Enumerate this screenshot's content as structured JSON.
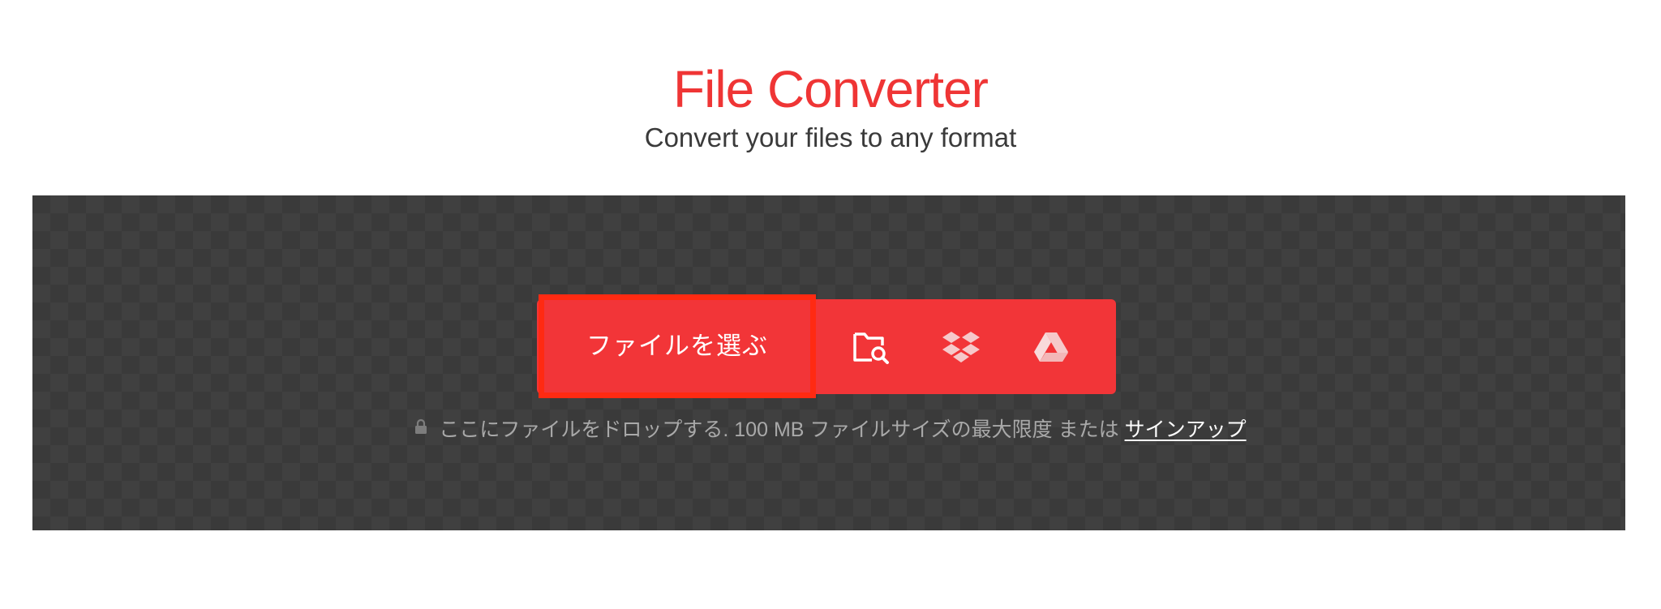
{
  "header": {
    "title": "File Converter",
    "subtitle": "Convert your files to any format"
  },
  "upload": {
    "choose_label": "ファイルを選ぶ",
    "sources": [
      {
        "name": "from-device",
        "icon": "folder-search-icon"
      },
      {
        "name": "dropbox",
        "icon": "dropbox-icon"
      },
      {
        "name": "google-drive",
        "icon": "google-drive-icon"
      }
    ],
    "hint_text": "ここにファイルをドロップする. 100 MB ファイルサイズの最大限度 または",
    "signup_link": "サインアップ"
  },
  "colors": {
    "accent": "#f23538",
    "title": "#ef3535",
    "highlight_border": "#ff2a12",
    "dropzone_bg": "#3a3a3a"
  }
}
